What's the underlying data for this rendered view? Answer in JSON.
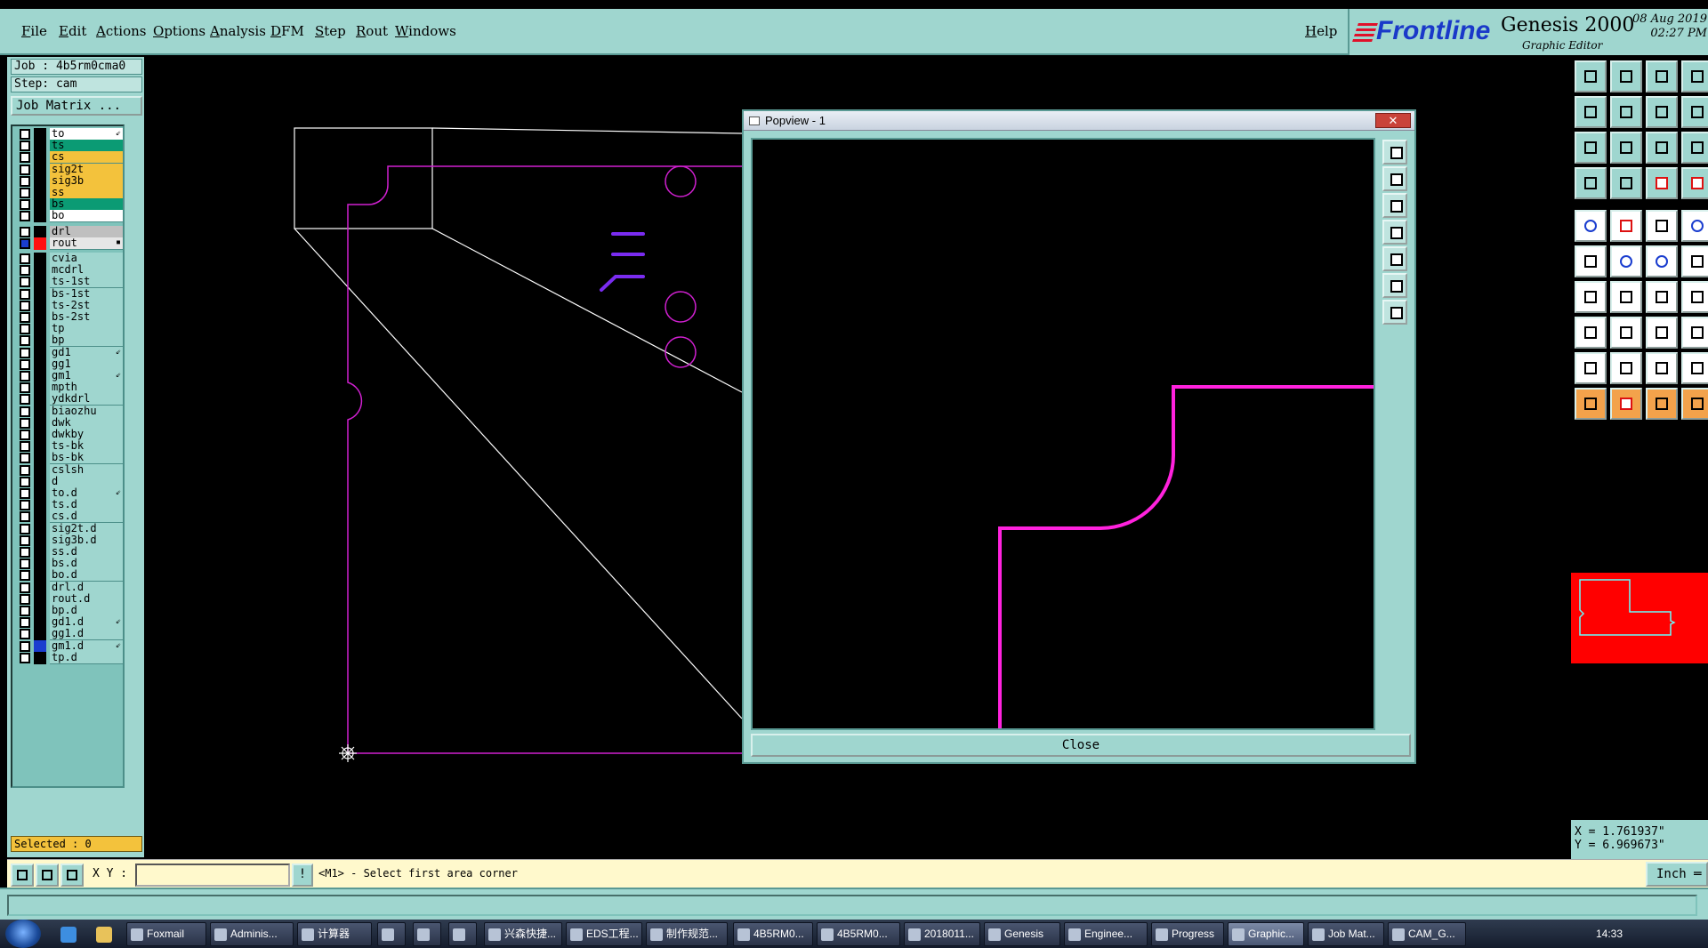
{
  "menu": [
    "File",
    "Edit",
    "Actions",
    "Options",
    "Analysis",
    "DFM",
    "Step",
    "Rout",
    "Windows"
  ],
  "help": "Help",
  "logo": {
    "brand": "Frontline",
    "product": "Genesis 2000",
    "subtitle": "Graphic Editor",
    "date": "08 Aug 2019",
    "time": "02:27 PM"
  },
  "job": "Job : 4b5rm0cma0",
  "step": "Step: cam",
  "job_matrix": "Job Matrix ...",
  "layers_group1": [
    {
      "name": "to",
      "color": "#ffffff",
      "mark": "⇙"
    },
    {
      "name": "ts",
      "color": "#0b9b74",
      "mark": ""
    },
    {
      "name": "cs",
      "color": "#f3c23c",
      "mark": ""
    },
    {
      "name": "sig2t",
      "color": "#f3c23c",
      "mark": ""
    },
    {
      "name": "sig3b",
      "color": "#f3c23c",
      "mark": ""
    },
    {
      "name": "ss",
      "color": "#f3c23c",
      "mark": ""
    },
    {
      "name": "bs",
      "color": "#0b9b74",
      "mark": ""
    },
    {
      "name": "bo",
      "color": "#ffffff",
      "mark": ""
    }
  ],
  "layers_group2": [
    {
      "name": "drl",
      "color": "#bfbfbf",
      "mark": ""
    },
    {
      "name": "rout",
      "color": "#e6e6e6",
      "mark": "▪"
    }
  ],
  "layers_group3": [
    {
      "name": "cvia",
      "mark": ""
    },
    {
      "name": "mcdrl",
      "mark": ""
    },
    {
      "name": "ts-1st",
      "mark": ""
    },
    {
      "name": "bs-1st",
      "mark": ""
    },
    {
      "name": "ts-2st",
      "mark": ""
    },
    {
      "name": "bs-2st",
      "mark": ""
    },
    {
      "name": "tp",
      "mark": ""
    },
    {
      "name": "bp",
      "mark": ""
    },
    {
      "name": "gd1",
      "mark": "⇙"
    },
    {
      "name": "gg1",
      "mark": ""
    },
    {
      "name": "gm1",
      "mark": "⇙"
    },
    {
      "name": "mpth",
      "mark": ""
    },
    {
      "name": "ydkdrl",
      "mark": ""
    },
    {
      "name": "biaozhu",
      "mark": ""
    },
    {
      "name": "dwk",
      "mark": ""
    },
    {
      "name": "dwkby",
      "mark": ""
    },
    {
      "name": "ts-bk",
      "mark": ""
    },
    {
      "name": "bs-bk",
      "mark": ""
    },
    {
      "name": "cslsh",
      "mark": ""
    },
    {
      "name": "d",
      "mark": ""
    },
    {
      "name": "to.d",
      "mark": "⇙"
    },
    {
      "name": "ts.d",
      "mark": ""
    },
    {
      "name": "cs.d",
      "mark": ""
    },
    {
      "name": "sig2t.d",
      "mark": ""
    },
    {
      "name": "sig3b.d",
      "mark": ""
    },
    {
      "name": "ss.d",
      "mark": ""
    },
    {
      "name": "bs.d",
      "mark": ""
    },
    {
      "name": "bo.d",
      "mark": ""
    },
    {
      "name": "drl.d",
      "mark": ""
    },
    {
      "name": "rout.d",
      "mark": ""
    },
    {
      "name": "bp.d",
      "mark": ""
    },
    {
      "name": "gd1.d",
      "mark": "⇙"
    },
    {
      "name": "gg1.d",
      "mark": ""
    },
    {
      "name": "gm1.d",
      "mark": "⇙"
    },
    {
      "name": "tp.d",
      "mark": ""
    }
  ],
  "selected": "Selected : 0",
  "popup": {
    "title": "Popview - 1",
    "close_x": "✕",
    "close_label": "Close"
  },
  "coords": {
    "x": "X = 1.761937\"",
    "y": "Y = 6.969673\""
  },
  "cmd": {
    "xy_label": "X Y :",
    "input_value": "",
    "exclaim": "!",
    "message": "<M1> - Select first area corner",
    "unit": "Inch ═"
  },
  "taskbar": {
    "items": [
      "Foxmail",
      "Adminis...",
      "计算器",
      "",
      "",
      "",
      "兴森快捷...",
      "EDS工程...",
      "制作规范...",
      "4B5RM0...",
      "4B5RM0...",
      "2018011...",
      "Genesis",
      "Enginee...",
      "Progress",
      "Graphic...",
      "Job Mat...",
      "CAM_G..."
    ],
    "clock": "14:33"
  },
  "colors": {
    "panel": "#9fd6cf",
    "rout_magenta": "#ff22dd",
    "feature_purple": "#a020e0"
  }
}
